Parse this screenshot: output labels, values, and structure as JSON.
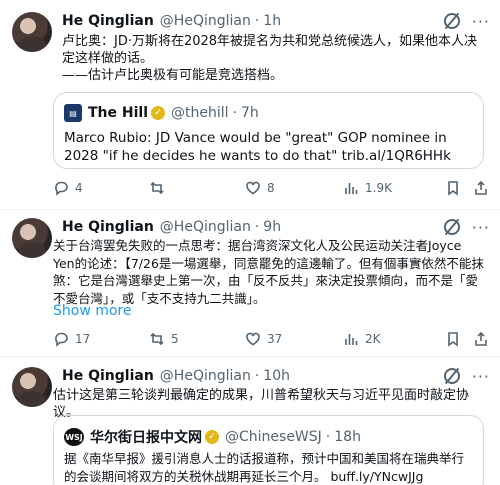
{
  "tweets": [
    {
      "name": "He Qinglian",
      "handle": "@HeQinglian",
      "time": "1h",
      "text": "卢比奥：JD·万斯将在2028年被提名为共和党总统候选人，如果他本人决定这样做的话。\n——估计卢比奥极有可能是竞选搭档。",
      "quote": {
        "name": "The Hill",
        "handle": "@thehill",
        "time": "7h",
        "logo_text": "THE HILL",
        "logo_color": "#1b3a6b",
        "text": "Marco Rubio: JD Vance would be \"great\" GOP nominee in 2028 \"if he decides he wants to do that\" trib.al/1QR6HHk"
      },
      "actions": {
        "replies": "4",
        "retweets": "",
        "likes": "8",
        "views": "1.9K"
      }
    },
    {
      "name": "He Qinglian",
      "handle": "@HeQinglian",
      "time": "9h",
      "text": "关于台湾罢免失败的一点思考：据台湾资深文化人及公民运动关注者Joyce Yen的论述：【7/26是一場選舉，同意罷免的這邊輸了。但有個事實依然不能抹煞：它是台灣選舉史上第一次，由「反不反共」來決定投票傾向，而不是「愛不愛台灣」，或「支不支持九二共識」。",
      "show_more": "Show more",
      "actions": {
        "replies": "17",
        "retweets": "5",
        "likes": "37",
        "views": "2K"
      }
    },
    {
      "name": "He Qinglian",
      "handle": "@HeQinglian",
      "time": "10h",
      "text": "估计这是第三轮谈判最确定的成果，川普希望秋天与习近平见面时敲定协议。",
      "quote": {
        "name": "华尔街日报中文网",
        "handle": "@ChineseWSJ",
        "time": "18h",
        "logo_text": "WSJ",
        "logo_color": "#111111",
        "text": "据《南华早报》援引消息人士的话报道称，预计中国和美国将在瑞典举行的会谈期间将双方的关税休战期再延长三个月。 buff.ly/YNcwJJg"
      }
    }
  ]
}
